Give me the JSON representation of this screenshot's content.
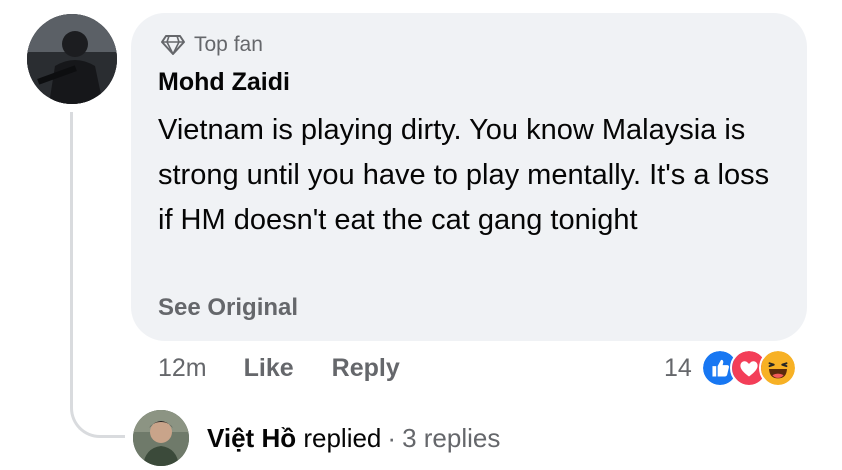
{
  "comment": {
    "badge_label": "Top fan",
    "badge_icon": "diamond-icon",
    "author": "Mohd Zaidi",
    "text": "Vietnam is playing dirty. You know Malaysia is strong until you have to play mentally. It's a loss if HM doesn't eat the cat gang tonight",
    "see_original": "See Original",
    "time": "12m",
    "like_label": "Like",
    "reply_label": "Reply",
    "reaction_count": "14",
    "reactions": [
      "like-reaction-icon",
      "love-reaction-icon",
      "haha-reaction-icon"
    ]
  },
  "replies": {
    "name": "Việt Hồ",
    "action": "replied",
    "separator": "·",
    "count_label": "3 replies"
  },
  "colors": {
    "bubble": "#f0f2f5",
    "secondary_text": "#65676b",
    "primary_text": "#050505",
    "like_blue": "#1877f2",
    "love_red": "#f33e58",
    "haha_yellow": "#f7b125"
  }
}
